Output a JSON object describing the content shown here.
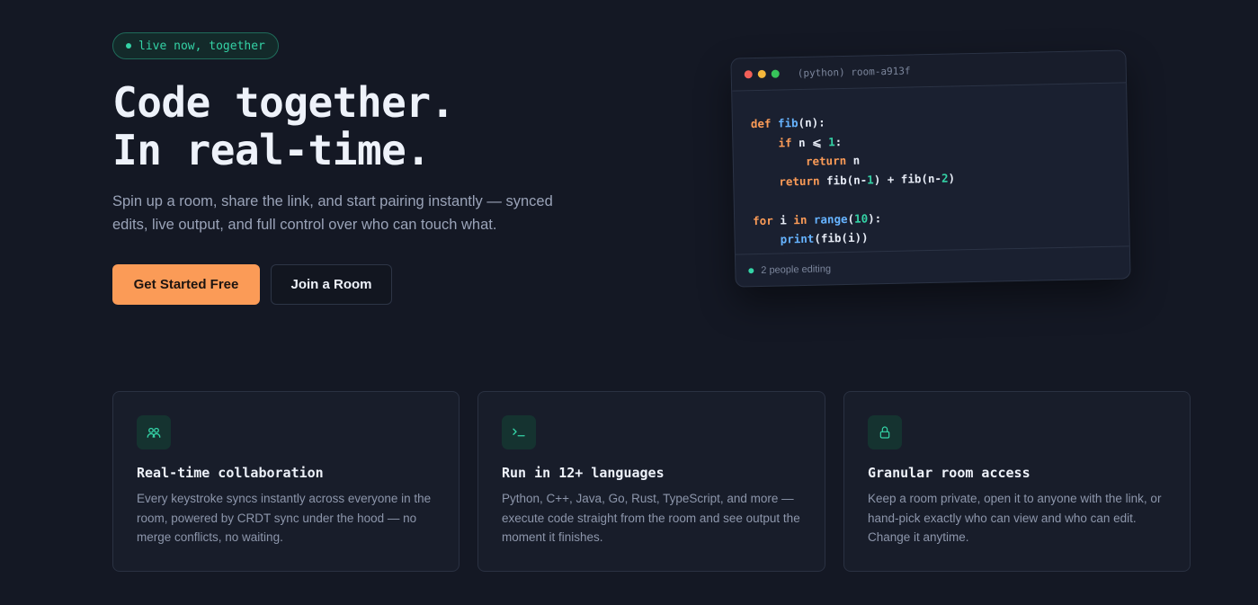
{
  "hero": {
    "badge": "live now, together",
    "title_line1": "Code together.",
    "title_line2": "In real-time.",
    "subtitle": "Spin up a room, share the link, and start pairing instantly — synced edits, live output, and full control over who can touch what.",
    "primary_button": "Get Started Free",
    "secondary_button": "Join a Room"
  },
  "editor": {
    "title": "(python) room-a913f",
    "status": "2 people editing",
    "language": "python"
  },
  "features": [
    {
      "icon": "users-icon",
      "title": "Real-time collaboration",
      "text": "Every keystroke syncs instantly across everyone in the room, powered by CRDT sync under the hood — no merge conflicts, no waiting."
    },
    {
      "icon": "terminal-icon",
      "title": "Run in 12+ languages",
      "text": "Python, C++, Java, Go, Rust, TypeScript, and more — execute code straight from the room and see output the moment it finishes."
    },
    {
      "icon": "lock-icon",
      "title": "Granular room access",
      "text": "Keep a room private, open it to anyone with the link, or hand-pick exactly who can view and who can edit. Change it anytime."
    }
  ],
  "colors": {
    "background": "#141824",
    "accent_orange": "#fb9b57",
    "accent_green": "#34d3a6",
    "keyword": "#fb9b57",
    "function": "#66b3ff",
    "number": "#34d3a6"
  }
}
